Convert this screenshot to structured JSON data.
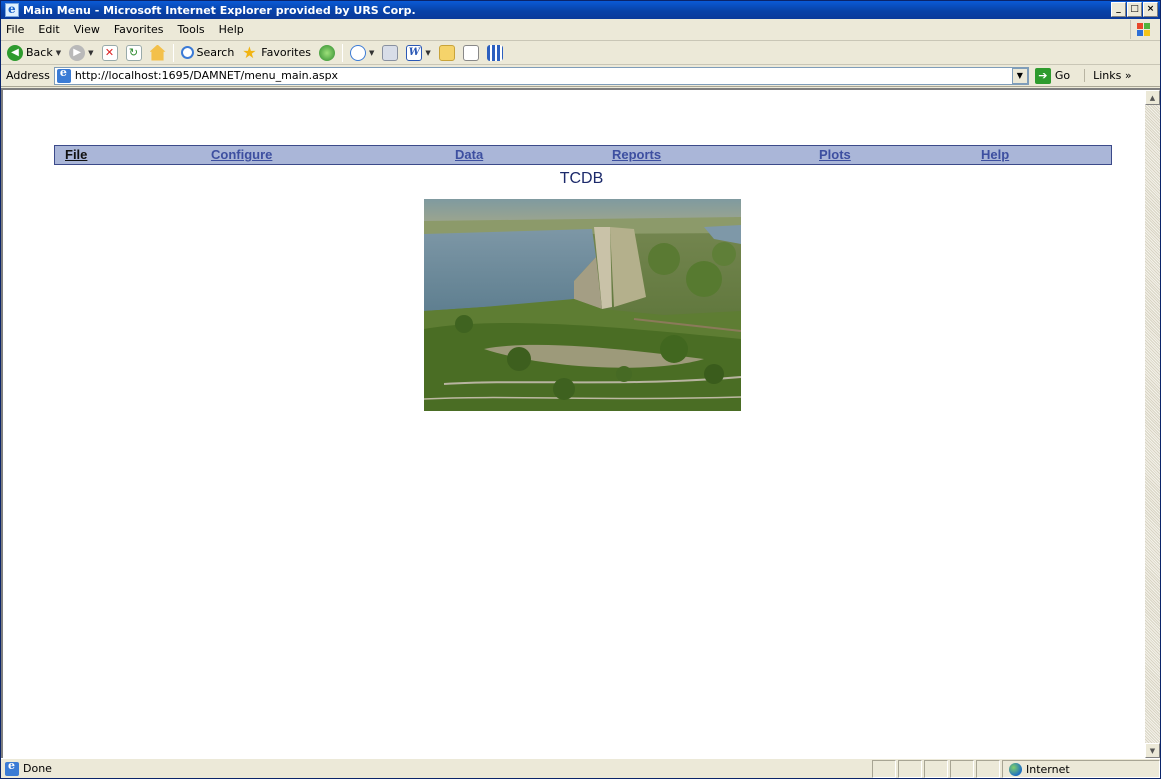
{
  "window": {
    "title": "Main Menu - Microsoft Internet Explorer provided by URS Corp.",
    "controls": {
      "minimize": "_",
      "maximize": "□",
      "close": "×"
    }
  },
  "menubar": {
    "items": [
      "File",
      "Edit",
      "View",
      "Favorites",
      "Tools",
      "Help"
    ]
  },
  "toolbar": {
    "back_label": "Back",
    "search_label": "Search",
    "favorites_label": "Favorites"
  },
  "address": {
    "label": "Address",
    "url": "http://localhost:1695/DAMNET/menu_main.aspx",
    "go_label": "Go",
    "links_label": "Links »"
  },
  "page": {
    "nav": {
      "items": [
        "File",
        "Configure",
        "Data",
        "Reports",
        "Plots",
        "Help"
      ]
    },
    "title": "TCDB"
  },
  "status": {
    "text": "Done",
    "zone": "Internet"
  },
  "colors": {
    "nav_background": "#aab6d8",
    "nav_link": "#3d4fa0",
    "title_text": "#1c2a6b",
    "titlebar": "#0842a8"
  }
}
